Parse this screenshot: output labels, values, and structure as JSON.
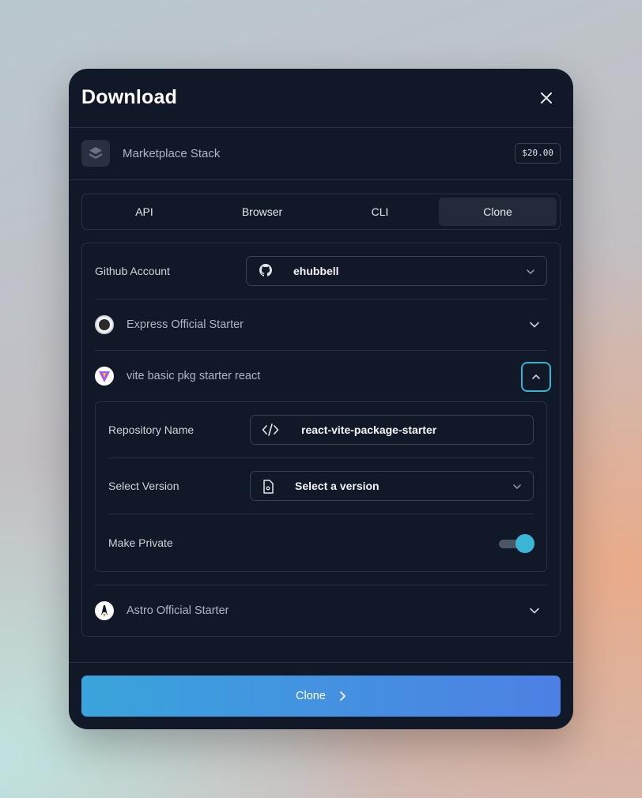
{
  "dialog": {
    "title": "Download"
  },
  "product": {
    "name": "Marketplace Stack",
    "price": "$20.00"
  },
  "tabs": [
    {
      "label": "API",
      "active": false
    },
    {
      "label": "Browser",
      "active": false
    },
    {
      "label": "CLI",
      "active": false
    },
    {
      "label": "Clone",
      "active": true
    }
  ],
  "github": {
    "label": "Github Account",
    "account": "ehubbell"
  },
  "starters": [
    {
      "name": "Express Official Starter",
      "logo": "express-logo",
      "expanded": false
    },
    {
      "name": "vite basic pkg starter react",
      "logo": "vite-logo",
      "expanded": true,
      "repo_label": "Repository Name",
      "repo_value": "react-vite-package-starter",
      "version_label": "Select Version",
      "version_placeholder": "Select a version",
      "private_label": "Make Private",
      "private_enabled": true
    },
    {
      "name": "Astro Official Starter",
      "logo": "astro-logo",
      "expanded": false
    }
  ],
  "footer": {
    "button_label": "Clone"
  },
  "colors": {
    "accent": "#39b3d5",
    "surface": "#111827",
    "border": "#283042"
  }
}
